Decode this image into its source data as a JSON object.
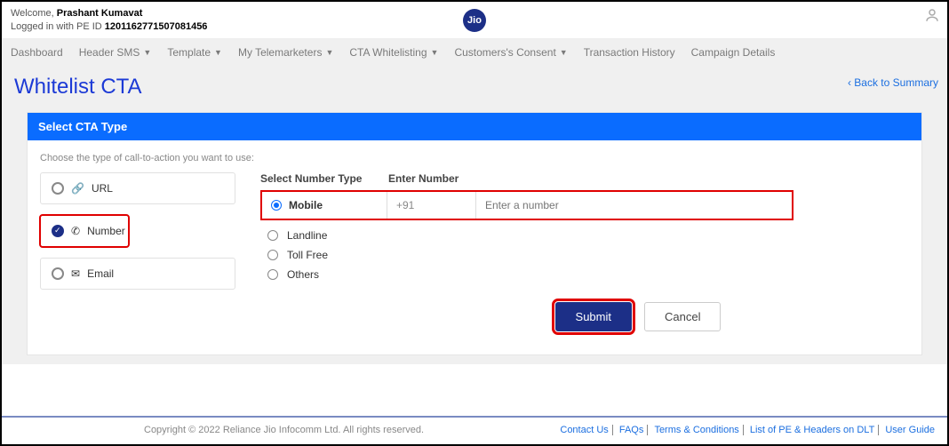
{
  "header": {
    "welcome_prefix": "Welcome, ",
    "user_name": "Prashant Kumavat",
    "logged_in_prefix": "Logged in with PE ID ",
    "pe_id": "1201162771507081456",
    "logo_text": "Jio"
  },
  "nav": {
    "items": [
      {
        "label": "Dashboard",
        "dropdown": false
      },
      {
        "label": "Header SMS",
        "dropdown": true
      },
      {
        "label": "Template",
        "dropdown": true
      },
      {
        "label": "My Telemarketers",
        "dropdown": true
      },
      {
        "label": "CTA Whitelisting",
        "dropdown": true
      },
      {
        "label": "Customers's Consent",
        "dropdown": true
      },
      {
        "label": "Transaction History",
        "dropdown": false
      },
      {
        "label": "Campaign Details",
        "dropdown": false
      }
    ]
  },
  "page": {
    "title": "Whitelist CTA",
    "back_link": "Back to Summary"
  },
  "card": {
    "title": "Select CTA Type",
    "hint": "Choose the type of call-to-action you want to use:"
  },
  "cta_options": [
    {
      "key": "url",
      "label": "URL",
      "icon": "🔗",
      "selected": false
    },
    {
      "key": "number",
      "label": "Number",
      "icon": "✆",
      "selected": true
    },
    {
      "key": "email",
      "label": "Email",
      "icon": "✉",
      "selected": false
    }
  ],
  "number_section": {
    "select_label": "Select Number Type",
    "enter_label": "Enter Number",
    "types": [
      {
        "key": "mobile",
        "label": "Mobile",
        "selected": true
      },
      {
        "key": "landline",
        "label": "Landline",
        "selected": false
      },
      {
        "key": "tollfree",
        "label": "Toll Free",
        "selected": false
      },
      {
        "key": "others",
        "label": "Others",
        "selected": false
      }
    ],
    "prefix": "+91",
    "input_placeholder": "Enter a number",
    "input_value": ""
  },
  "buttons": {
    "submit": "Submit",
    "cancel": "Cancel"
  },
  "footer": {
    "copyright": "Copyright © 2022 Reliance Jio Infocomm Ltd. All rights reserved.",
    "links": [
      "Contact Us",
      "FAQs",
      "Terms & Conditions",
      "List of PE & Headers on DLT",
      "User Guide"
    ]
  }
}
